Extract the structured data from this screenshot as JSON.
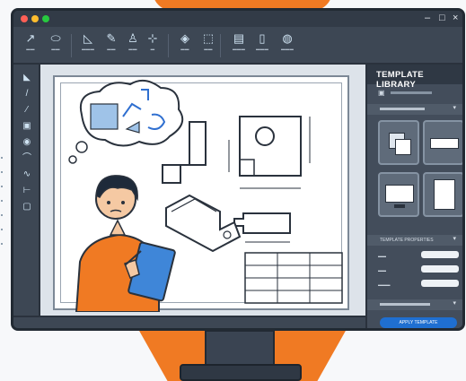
{
  "window": {
    "controls": {
      "minimize": "–",
      "maximize": "□",
      "close": "×"
    }
  },
  "toolbar": {
    "tools": [
      {
        "icon": "pen-icon"
      },
      {
        "icon": "ellipse-icon"
      },
      {
        "icon": "polygon-icon"
      },
      {
        "icon": "pencil-icon"
      },
      {
        "icon": "person-icon"
      },
      {
        "icon": "measure-icon"
      },
      {
        "icon": "layers-icon"
      },
      {
        "icon": "cube-icon"
      },
      {
        "icon": "template-icon"
      },
      {
        "icon": "document-icon"
      },
      {
        "icon": "globe-icon"
      }
    ]
  },
  "sidebar": {
    "title": "TEMPLATE LIBRARY",
    "properties_heading": "TEMPLATE PROPERTIES",
    "apply_button": "APPLY TEMPLATE"
  },
  "colors": {
    "accent_orange": "#f07a23",
    "apply_blue": "#1f6fd1",
    "ui_dark": "#3d4754"
  }
}
